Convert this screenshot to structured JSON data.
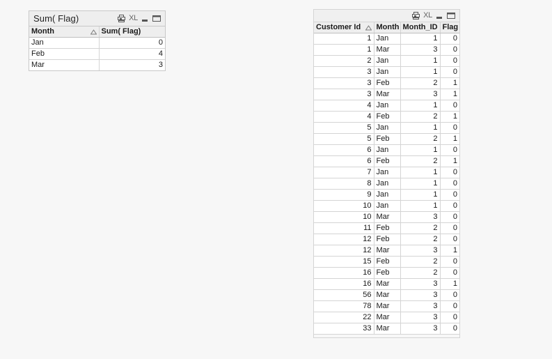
{
  "theme": {
    "page_background": "#f7f7f7",
    "caption_background": "#eeeeee",
    "header_background": "#eeeeee",
    "cell_background": "#ffffff",
    "border_color": "#d4d4d4",
    "text_color": "#1a1a1a"
  },
  "caption_buttons": {
    "print_icon": "print-icon",
    "excel_label": "XL",
    "minimize_icon": "minimize-icon",
    "maximize_icon": "maximize-icon"
  },
  "chart": {
    "title": "Sum( Flag)",
    "sort_column_index": 0,
    "sort_direction": "ascending",
    "columns": [
      {
        "label": "Month",
        "align": "left"
      },
      {
        "label": "Sum( Flag)",
        "align": "right"
      }
    ],
    "rows": [
      [
        "Jan",
        "0"
      ],
      [
        "Feb",
        "4"
      ],
      [
        "Mar",
        "3"
      ]
    ]
  },
  "tablebox": {
    "title": "",
    "sort_column_index": 0,
    "sort_direction": "ascending",
    "columns": [
      {
        "label": "Customer Id",
        "align": "right"
      },
      {
        "label": "Month",
        "align": "left"
      },
      {
        "label": "Month_ID",
        "align": "right"
      },
      {
        "label": "Flag",
        "align": "right"
      }
    ],
    "rows": [
      [
        "1",
        "Jan",
        "1",
        "0"
      ],
      [
        "1",
        "Mar",
        "3",
        "0"
      ],
      [
        "2",
        "Jan",
        "1",
        "0"
      ],
      [
        "3",
        "Jan",
        "1",
        "0"
      ],
      [
        "3",
        "Feb",
        "2",
        "1"
      ],
      [
        "3",
        "Mar",
        "3",
        "1"
      ],
      [
        "4",
        "Jan",
        "1",
        "0"
      ],
      [
        "4",
        "Feb",
        "2",
        "1"
      ],
      [
        "5",
        "Jan",
        "1",
        "0"
      ],
      [
        "5",
        "Feb",
        "2",
        "1"
      ],
      [
        "6",
        "Jan",
        "1",
        "0"
      ],
      [
        "6",
        "Feb",
        "2",
        "1"
      ],
      [
        "7",
        "Jan",
        "1",
        "0"
      ],
      [
        "8",
        "Jan",
        "1",
        "0"
      ],
      [
        "9",
        "Jan",
        "1",
        "0"
      ],
      [
        "10",
        "Jan",
        "1",
        "0"
      ],
      [
        "10",
        "Mar",
        "3",
        "0"
      ],
      [
        "11",
        "Feb",
        "2",
        "0"
      ],
      [
        "12",
        "Feb",
        "2",
        "0"
      ],
      [
        "12",
        "Mar",
        "3",
        "1"
      ],
      [
        "15",
        "Feb",
        "2",
        "0"
      ],
      [
        "16",
        "Feb",
        "2",
        "0"
      ],
      [
        "16",
        "Mar",
        "3",
        "1"
      ],
      [
        "56",
        "Mar",
        "3",
        "0"
      ],
      [
        "78",
        "Mar",
        "3",
        "0"
      ],
      [
        "22",
        "Mar",
        "3",
        "0"
      ],
      [
        "33",
        "Mar",
        "3",
        "0"
      ]
    ]
  }
}
